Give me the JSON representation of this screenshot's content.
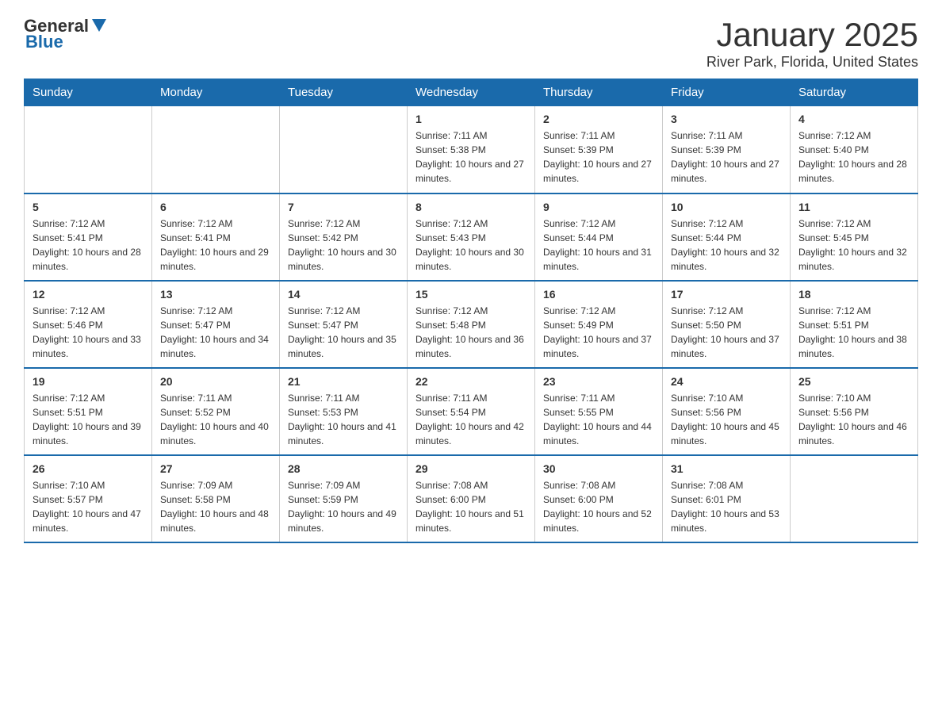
{
  "logo": {
    "general": "General",
    "blue": "Blue"
  },
  "header": {
    "month": "January 2025",
    "location": "River Park, Florida, United States"
  },
  "weekdays": [
    "Sunday",
    "Monday",
    "Tuesday",
    "Wednesday",
    "Thursday",
    "Friday",
    "Saturday"
  ],
  "weeks": [
    [
      {
        "day": "",
        "sunrise": "",
        "sunset": "",
        "daylight": ""
      },
      {
        "day": "",
        "sunrise": "",
        "sunset": "",
        "daylight": ""
      },
      {
        "day": "",
        "sunrise": "",
        "sunset": "",
        "daylight": ""
      },
      {
        "day": "1",
        "sunrise": "Sunrise: 7:11 AM",
        "sunset": "Sunset: 5:38 PM",
        "daylight": "Daylight: 10 hours and 27 minutes."
      },
      {
        "day": "2",
        "sunrise": "Sunrise: 7:11 AM",
        "sunset": "Sunset: 5:39 PM",
        "daylight": "Daylight: 10 hours and 27 minutes."
      },
      {
        "day": "3",
        "sunrise": "Sunrise: 7:11 AM",
        "sunset": "Sunset: 5:39 PM",
        "daylight": "Daylight: 10 hours and 27 minutes."
      },
      {
        "day": "4",
        "sunrise": "Sunrise: 7:12 AM",
        "sunset": "Sunset: 5:40 PM",
        "daylight": "Daylight: 10 hours and 28 minutes."
      }
    ],
    [
      {
        "day": "5",
        "sunrise": "Sunrise: 7:12 AM",
        "sunset": "Sunset: 5:41 PM",
        "daylight": "Daylight: 10 hours and 28 minutes."
      },
      {
        "day": "6",
        "sunrise": "Sunrise: 7:12 AM",
        "sunset": "Sunset: 5:41 PM",
        "daylight": "Daylight: 10 hours and 29 minutes."
      },
      {
        "day": "7",
        "sunrise": "Sunrise: 7:12 AM",
        "sunset": "Sunset: 5:42 PM",
        "daylight": "Daylight: 10 hours and 30 minutes."
      },
      {
        "day": "8",
        "sunrise": "Sunrise: 7:12 AM",
        "sunset": "Sunset: 5:43 PM",
        "daylight": "Daylight: 10 hours and 30 minutes."
      },
      {
        "day": "9",
        "sunrise": "Sunrise: 7:12 AM",
        "sunset": "Sunset: 5:44 PM",
        "daylight": "Daylight: 10 hours and 31 minutes."
      },
      {
        "day": "10",
        "sunrise": "Sunrise: 7:12 AM",
        "sunset": "Sunset: 5:44 PM",
        "daylight": "Daylight: 10 hours and 32 minutes."
      },
      {
        "day": "11",
        "sunrise": "Sunrise: 7:12 AM",
        "sunset": "Sunset: 5:45 PM",
        "daylight": "Daylight: 10 hours and 32 minutes."
      }
    ],
    [
      {
        "day": "12",
        "sunrise": "Sunrise: 7:12 AM",
        "sunset": "Sunset: 5:46 PM",
        "daylight": "Daylight: 10 hours and 33 minutes."
      },
      {
        "day": "13",
        "sunrise": "Sunrise: 7:12 AM",
        "sunset": "Sunset: 5:47 PM",
        "daylight": "Daylight: 10 hours and 34 minutes."
      },
      {
        "day": "14",
        "sunrise": "Sunrise: 7:12 AM",
        "sunset": "Sunset: 5:47 PM",
        "daylight": "Daylight: 10 hours and 35 minutes."
      },
      {
        "day": "15",
        "sunrise": "Sunrise: 7:12 AM",
        "sunset": "Sunset: 5:48 PM",
        "daylight": "Daylight: 10 hours and 36 minutes."
      },
      {
        "day": "16",
        "sunrise": "Sunrise: 7:12 AM",
        "sunset": "Sunset: 5:49 PM",
        "daylight": "Daylight: 10 hours and 37 minutes."
      },
      {
        "day": "17",
        "sunrise": "Sunrise: 7:12 AM",
        "sunset": "Sunset: 5:50 PM",
        "daylight": "Daylight: 10 hours and 37 minutes."
      },
      {
        "day": "18",
        "sunrise": "Sunrise: 7:12 AM",
        "sunset": "Sunset: 5:51 PM",
        "daylight": "Daylight: 10 hours and 38 minutes."
      }
    ],
    [
      {
        "day": "19",
        "sunrise": "Sunrise: 7:12 AM",
        "sunset": "Sunset: 5:51 PM",
        "daylight": "Daylight: 10 hours and 39 minutes."
      },
      {
        "day": "20",
        "sunrise": "Sunrise: 7:11 AM",
        "sunset": "Sunset: 5:52 PM",
        "daylight": "Daylight: 10 hours and 40 minutes."
      },
      {
        "day": "21",
        "sunrise": "Sunrise: 7:11 AM",
        "sunset": "Sunset: 5:53 PM",
        "daylight": "Daylight: 10 hours and 41 minutes."
      },
      {
        "day": "22",
        "sunrise": "Sunrise: 7:11 AM",
        "sunset": "Sunset: 5:54 PM",
        "daylight": "Daylight: 10 hours and 42 minutes."
      },
      {
        "day": "23",
        "sunrise": "Sunrise: 7:11 AM",
        "sunset": "Sunset: 5:55 PM",
        "daylight": "Daylight: 10 hours and 44 minutes."
      },
      {
        "day": "24",
        "sunrise": "Sunrise: 7:10 AM",
        "sunset": "Sunset: 5:56 PM",
        "daylight": "Daylight: 10 hours and 45 minutes."
      },
      {
        "day": "25",
        "sunrise": "Sunrise: 7:10 AM",
        "sunset": "Sunset: 5:56 PM",
        "daylight": "Daylight: 10 hours and 46 minutes."
      }
    ],
    [
      {
        "day": "26",
        "sunrise": "Sunrise: 7:10 AM",
        "sunset": "Sunset: 5:57 PM",
        "daylight": "Daylight: 10 hours and 47 minutes."
      },
      {
        "day": "27",
        "sunrise": "Sunrise: 7:09 AM",
        "sunset": "Sunset: 5:58 PM",
        "daylight": "Daylight: 10 hours and 48 minutes."
      },
      {
        "day": "28",
        "sunrise": "Sunrise: 7:09 AM",
        "sunset": "Sunset: 5:59 PM",
        "daylight": "Daylight: 10 hours and 49 minutes."
      },
      {
        "day": "29",
        "sunrise": "Sunrise: 7:08 AM",
        "sunset": "Sunset: 6:00 PM",
        "daylight": "Daylight: 10 hours and 51 minutes."
      },
      {
        "day": "30",
        "sunrise": "Sunrise: 7:08 AM",
        "sunset": "Sunset: 6:00 PM",
        "daylight": "Daylight: 10 hours and 52 minutes."
      },
      {
        "day": "31",
        "sunrise": "Sunrise: 7:08 AM",
        "sunset": "Sunset: 6:01 PM",
        "daylight": "Daylight: 10 hours and 53 minutes."
      },
      {
        "day": "",
        "sunrise": "",
        "sunset": "",
        "daylight": ""
      }
    ]
  ]
}
